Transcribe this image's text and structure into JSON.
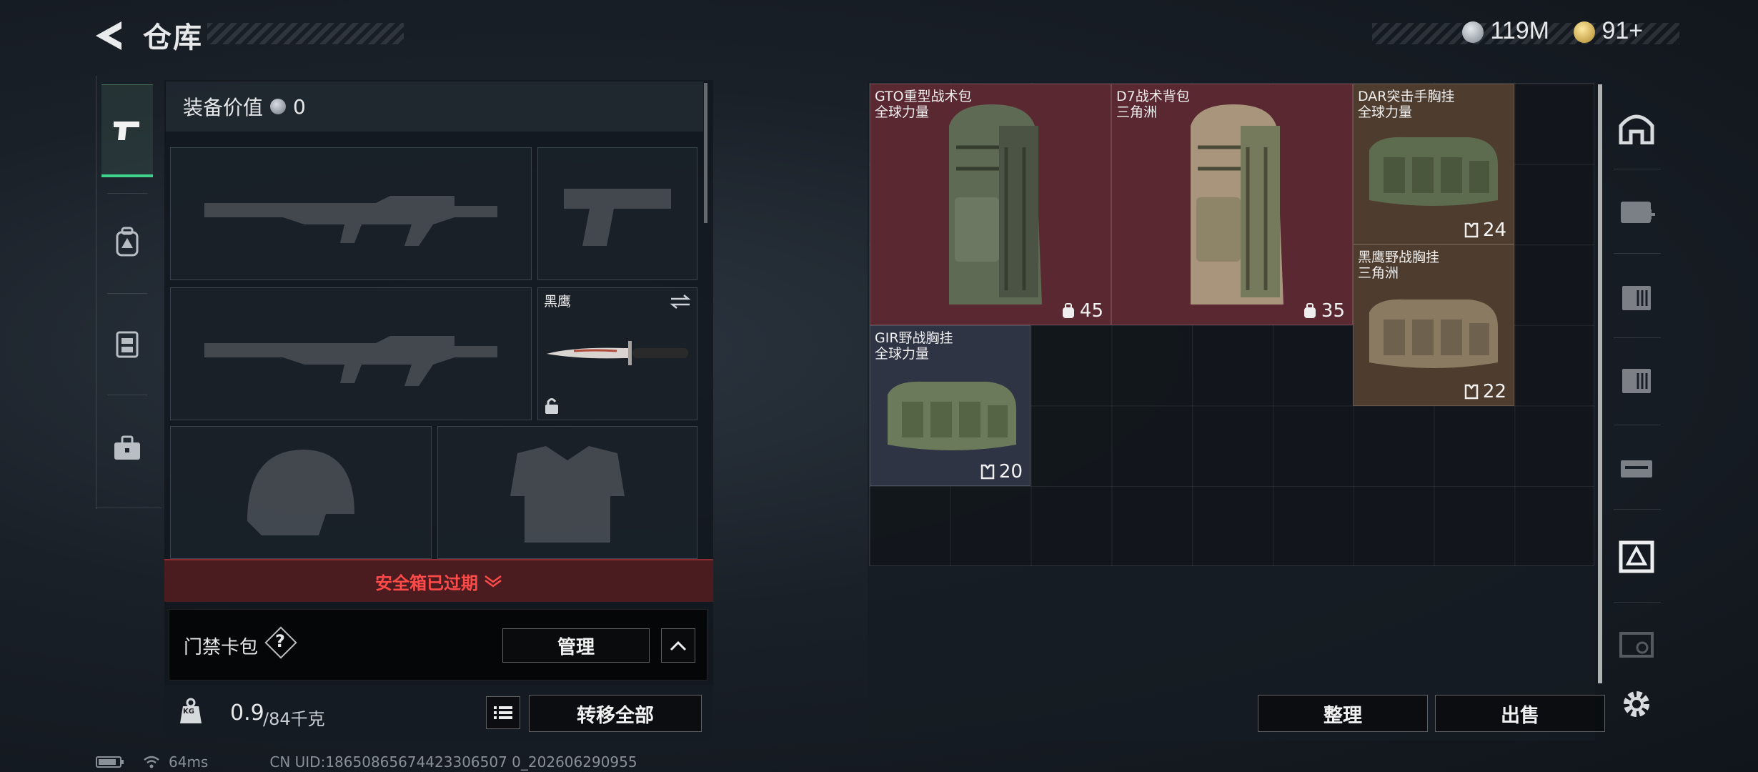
{
  "header": {
    "title": "仓库"
  },
  "currency": {
    "silver": "119M",
    "gold": "91+"
  },
  "left_tabs": [
    "weapon",
    "backpack",
    "chest-rig",
    "case"
  ],
  "equipment": {
    "value_label": "装备价值",
    "value": "0",
    "melee_name": "黑鹰",
    "safe_box_status": "安全箱已过期",
    "card_bag_label": "门禁卡包",
    "card_bag_help": "?",
    "manage_label": "管理",
    "weight": "0.9",
    "weight_limit": "/84千克",
    "weight_icon_label": "KG",
    "transfer_all_label": "转移全部"
  },
  "items": [
    {
      "name": "GTO重型战术包",
      "source": "全球力量",
      "capacity": "45",
      "kind": "backpack"
    },
    {
      "name": "D7战术背包",
      "source": "三角洲",
      "capacity": "35",
      "kind": "backpack"
    },
    {
      "name": "DAR突击手胸挂",
      "source": "全球力量",
      "capacity": "24",
      "kind": "chest-rig"
    },
    {
      "name": "黑鹰野战胸挂",
      "source": "三角洲",
      "capacity": "22",
      "kind": "chest-rig"
    },
    {
      "name": "GIR野战胸挂",
      "source": "全球力量",
      "capacity": "20",
      "kind": "chest-rig"
    }
  ],
  "actions": {
    "sort_label": "整理",
    "sell_label": "出售"
  },
  "right_rail": [
    "home-icon",
    "medical-box-icon",
    "ammo-box-icon",
    "ammo-box-icon-2",
    "weapon-case-icon",
    "equipment-case-icon",
    "gadget-case-icon",
    "settings-icon"
  ],
  "status_bar": {
    "ping": "64ms",
    "uid": "CN UID:18650865674423306507 0_202606290955"
  },
  "colors": {
    "backpack_bg": "#5a2830",
    "chest_rig_bg": "#4e3d2e",
    "gir_bg": "#2f3445",
    "alert": "#ff4a4a",
    "active_tab": "#3fd28a"
  }
}
